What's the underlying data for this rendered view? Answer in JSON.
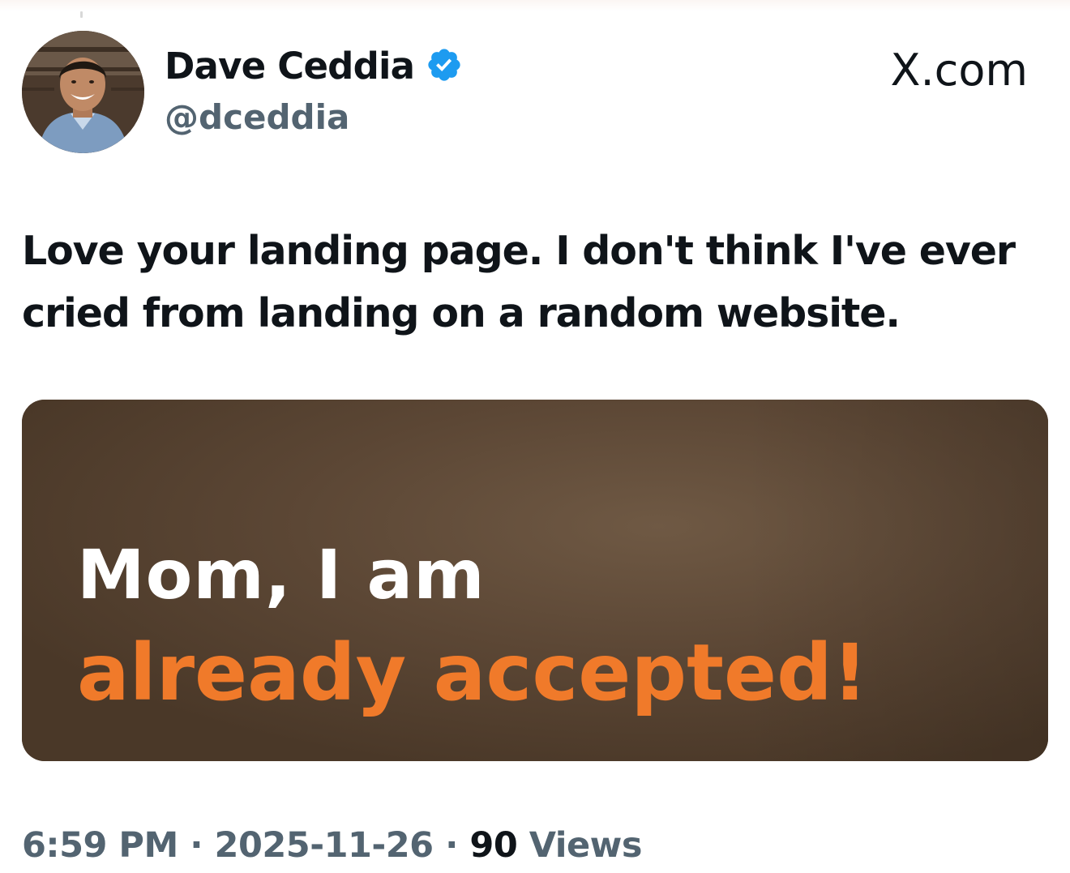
{
  "tweet": {
    "author": {
      "display_name": "Dave Ceddia",
      "handle": "@dceddia",
      "verified": true,
      "verified_badge_color": "#1d9bf0"
    },
    "brand_label": "X.com",
    "text": "Love your landing page. I don't think I've ever cried from landing on a random website.",
    "media": {
      "line1": "Mom, I am",
      "line2": "already accepted!",
      "text_colors": {
        "line1": "#ffffff",
        "line2": "#f07a2a"
      },
      "background_color": "#5b4634"
    },
    "meta": {
      "time": "6:59 PM",
      "separator": "·",
      "date": "2025-11-26",
      "views_count": "90",
      "views_label": "Views"
    }
  },
  "icons": {
    "verified": "verified-badge-icon",
    "brand": "x-logo-icon"
  }
}
